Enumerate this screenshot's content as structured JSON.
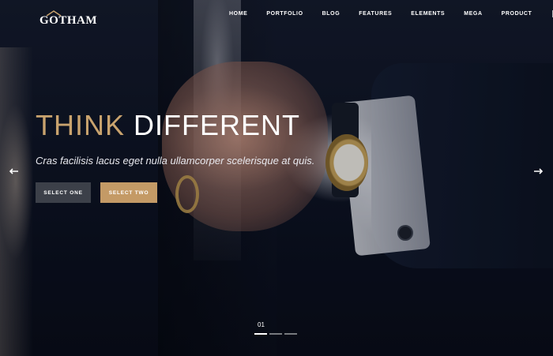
{
  "brand": {
    "logo_text": "GOTHAM"
  },
  "nav": {
    "items": [
      "HOME",
      "PORTFOLIO",
      "BLOG",
      "FEATURES",
      "ELEMENTS",
      "MEGA",
      "PRODUCT"
    ],
    "icons": [
      "refresh-icon",
      "search-icon"
    ]
  },
  "hero": {
    "headline_part1": "THINK",
    "headline_part2": "DIFFERENT",
    "subtitle": "Cras facilisis lacus eget nulla ullamcorper scelerisque at quis.",
    "button_one": "SELECT ONE",
    "button_two": "SELECT TWO"
  },
  "slider": {
    "current": "01",
    "total_slides": 3,
    "active_index": 0
  },
  "colors": {
    "accent": "#c9a36e",
    "button_dark": "#3c4049",
    "button_gold": "#c49a66",
    "background": "#0e1220"
  }
}
